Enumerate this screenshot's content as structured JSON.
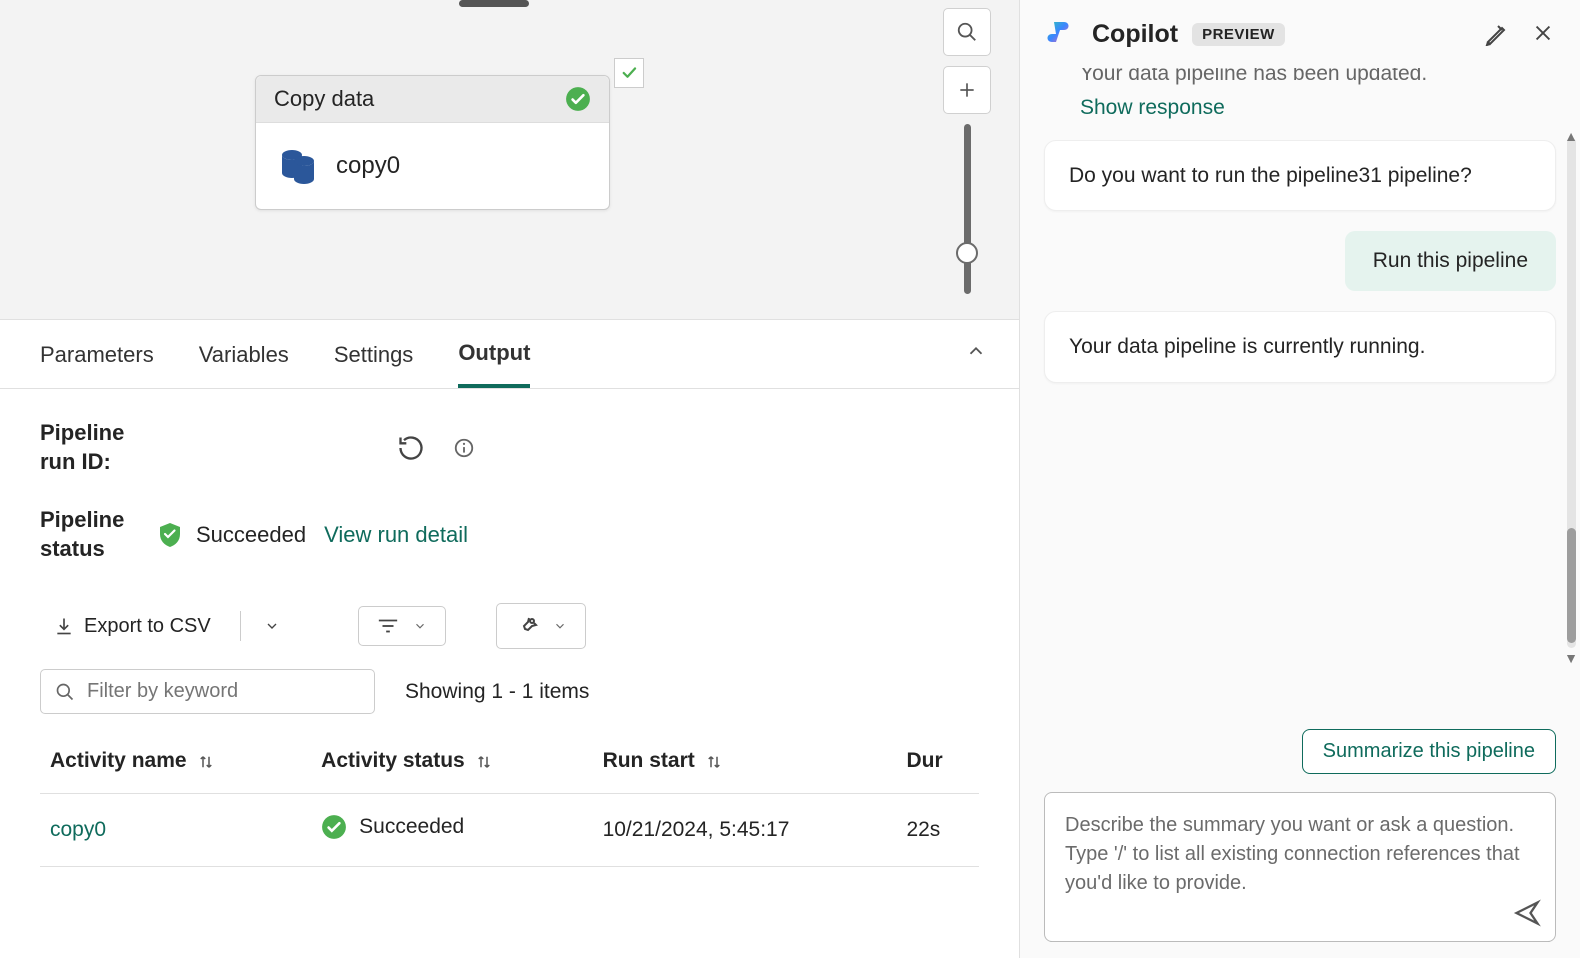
{
  "canvas": {
    "activity_title": "Copy data",
    "activity_name": "copy0"
  },
  "tabs": {
    "parameters": "Parameters",
    "variables": "Variables",
    "settings": "Settings",
    "output": "Output"
  },
  "output": {
    "run_id_label": "Pipeline run ID:",
    "status_label": "Pipeline status",
    "status_value": "Succeeded",
    "view_detail": "View run detail",
    "export_csv": "Export to CSV",
    "filter_placeholder": "Filter by keyword",
    "showing": "Showing 1 - 1 items",
    "columns": {
      "activity_name": "Activity name",
      "activity_status": "Activity status",
      "run_start": "Run start",
      "duration": "Dur"
    },
    "rows": [
      {
        "name": "copy0",
        "status": "Succeeded",
        "start": "10/21/2024, 5:45:17",
        "duration": "22s"
      }
    ]
  },
  "copilot": {
    "title": "Copilot",
    "badge": "PREVIEW",
    "truncated": "Your data pipeline has been updated.",
    "show_response": "Show response",
    "msg1": "Do you want to run the pipeline31 pipeline?",
    "user_msg": "Run this pipeline",
    "msg2": "Your data pipeline is currently running.",
    "suggestion": "Summarize this pipeline",
    "placeholder": "Describe the summary you want or ask a question.\nType '/' to list all existing connection references that you'd like to provide."
  }
}
